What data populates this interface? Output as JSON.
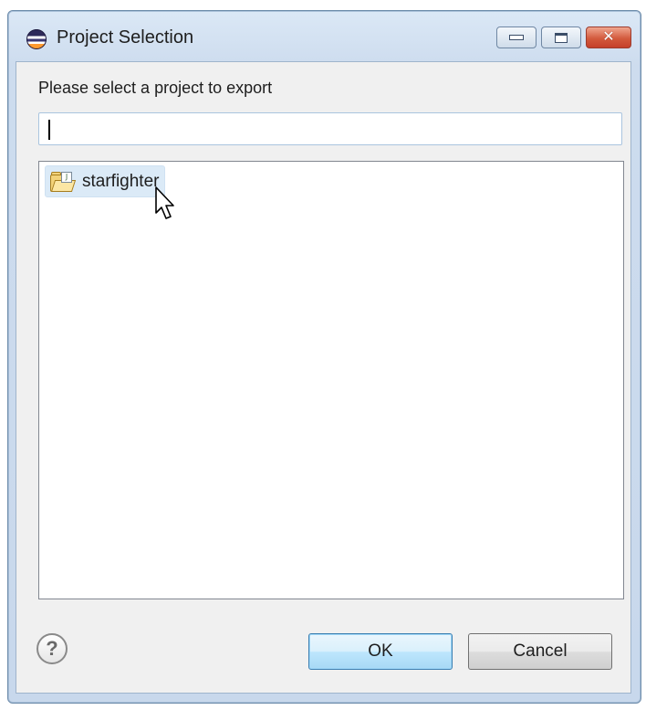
{
  "window": {
    "title": "Project Selection",
    "buttons": {
      "minimize": "minimize",
      "maximize": "maximize",
      "close": "✕"
    }
  },
  "dialog": {
    "prompt": "Please select a project to export",
    "filter": {
      "value": "",
      "placeholder": ""
    },
    "projects": [
      {
        "name": "starfighter",
        "icon": "java-project-folder-icon",
        "selected": true
      }
    ]
  },
  "footer": {
    "help_icon": "?",
    "ok_label": "OK",
    "cancel_label": "Cancel"
  },
  "colors": {
    "title_gradient_top": "#dbe8f6",
    "selection": "#dbeaf7",
    "ok_border": "#3c7fb1",
    "close_button": "#d35a3d"
  }
}
